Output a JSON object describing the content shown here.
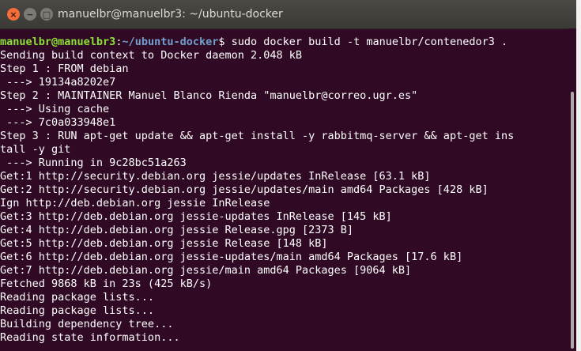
{
  "window": {
    "title": "manuelbr@manuelbr3: ~/ubuntu-docker"
  },
  "controls": {
    "close": "×",
    "minimize": "−",
    "maximize": "□"
  },
  "prompt": {
    "user_host": "manuelbr@manuelbr3",
    "colon": ":",
    "path": "~/ubuntu-docker",
    "dollar": "$",
    "command": " sudo docker build -t manuelbr/contenedor3 ."
  },
  "output": [
    "Sending build context to Docker daemon 2.048 kB",
    "Step 1 : FROM debian",
    " ---> 19134a8202e7",
    "Step 2 : MAINTAINER Manuel Blanco Rienda \"manuelbr@correo.ugr.es\"",
    " ---> Using cache",
    " ---> 7c0a033948e1",
    "Step 3 : RUN apt-get update && apt-get install -y rabbitmq-server && apt-get ins",
    "tall -y git",
    " ---> Running in 9c28bc51a263",
    "Get:1 http://security.debian.org jessie/updates InRelease [63.1 kB]",
    "Get:2 http://security.debian.org jessie/updates/main amd64 Packages [428 kB]",
    "Ign http://deb.debian.org jessie InRelease",
    "Get:3 http://deb.debian.org jessie-updates InRelease [145 kB]",
    "Get:4 http://deb.debian.org jessie Release.gpg [2373 B]",
    "Get:5 http://deb.debian.org jessie Release [148 kB]",
    "Get:6 http://deb.debian.org jessie-updates/main amd64 Packages [17.6 kB]",
    "Get:7 http://deb.debian.org jessie/main amd64 Packages [9064 kB]",
    "Fetched 9868 kB in 23s (425 kB/s)",
    "Reading package lists...",
    "Reading package lists...",
    "Building dependency tree...",
    "Reading state information..."
  ]
}
